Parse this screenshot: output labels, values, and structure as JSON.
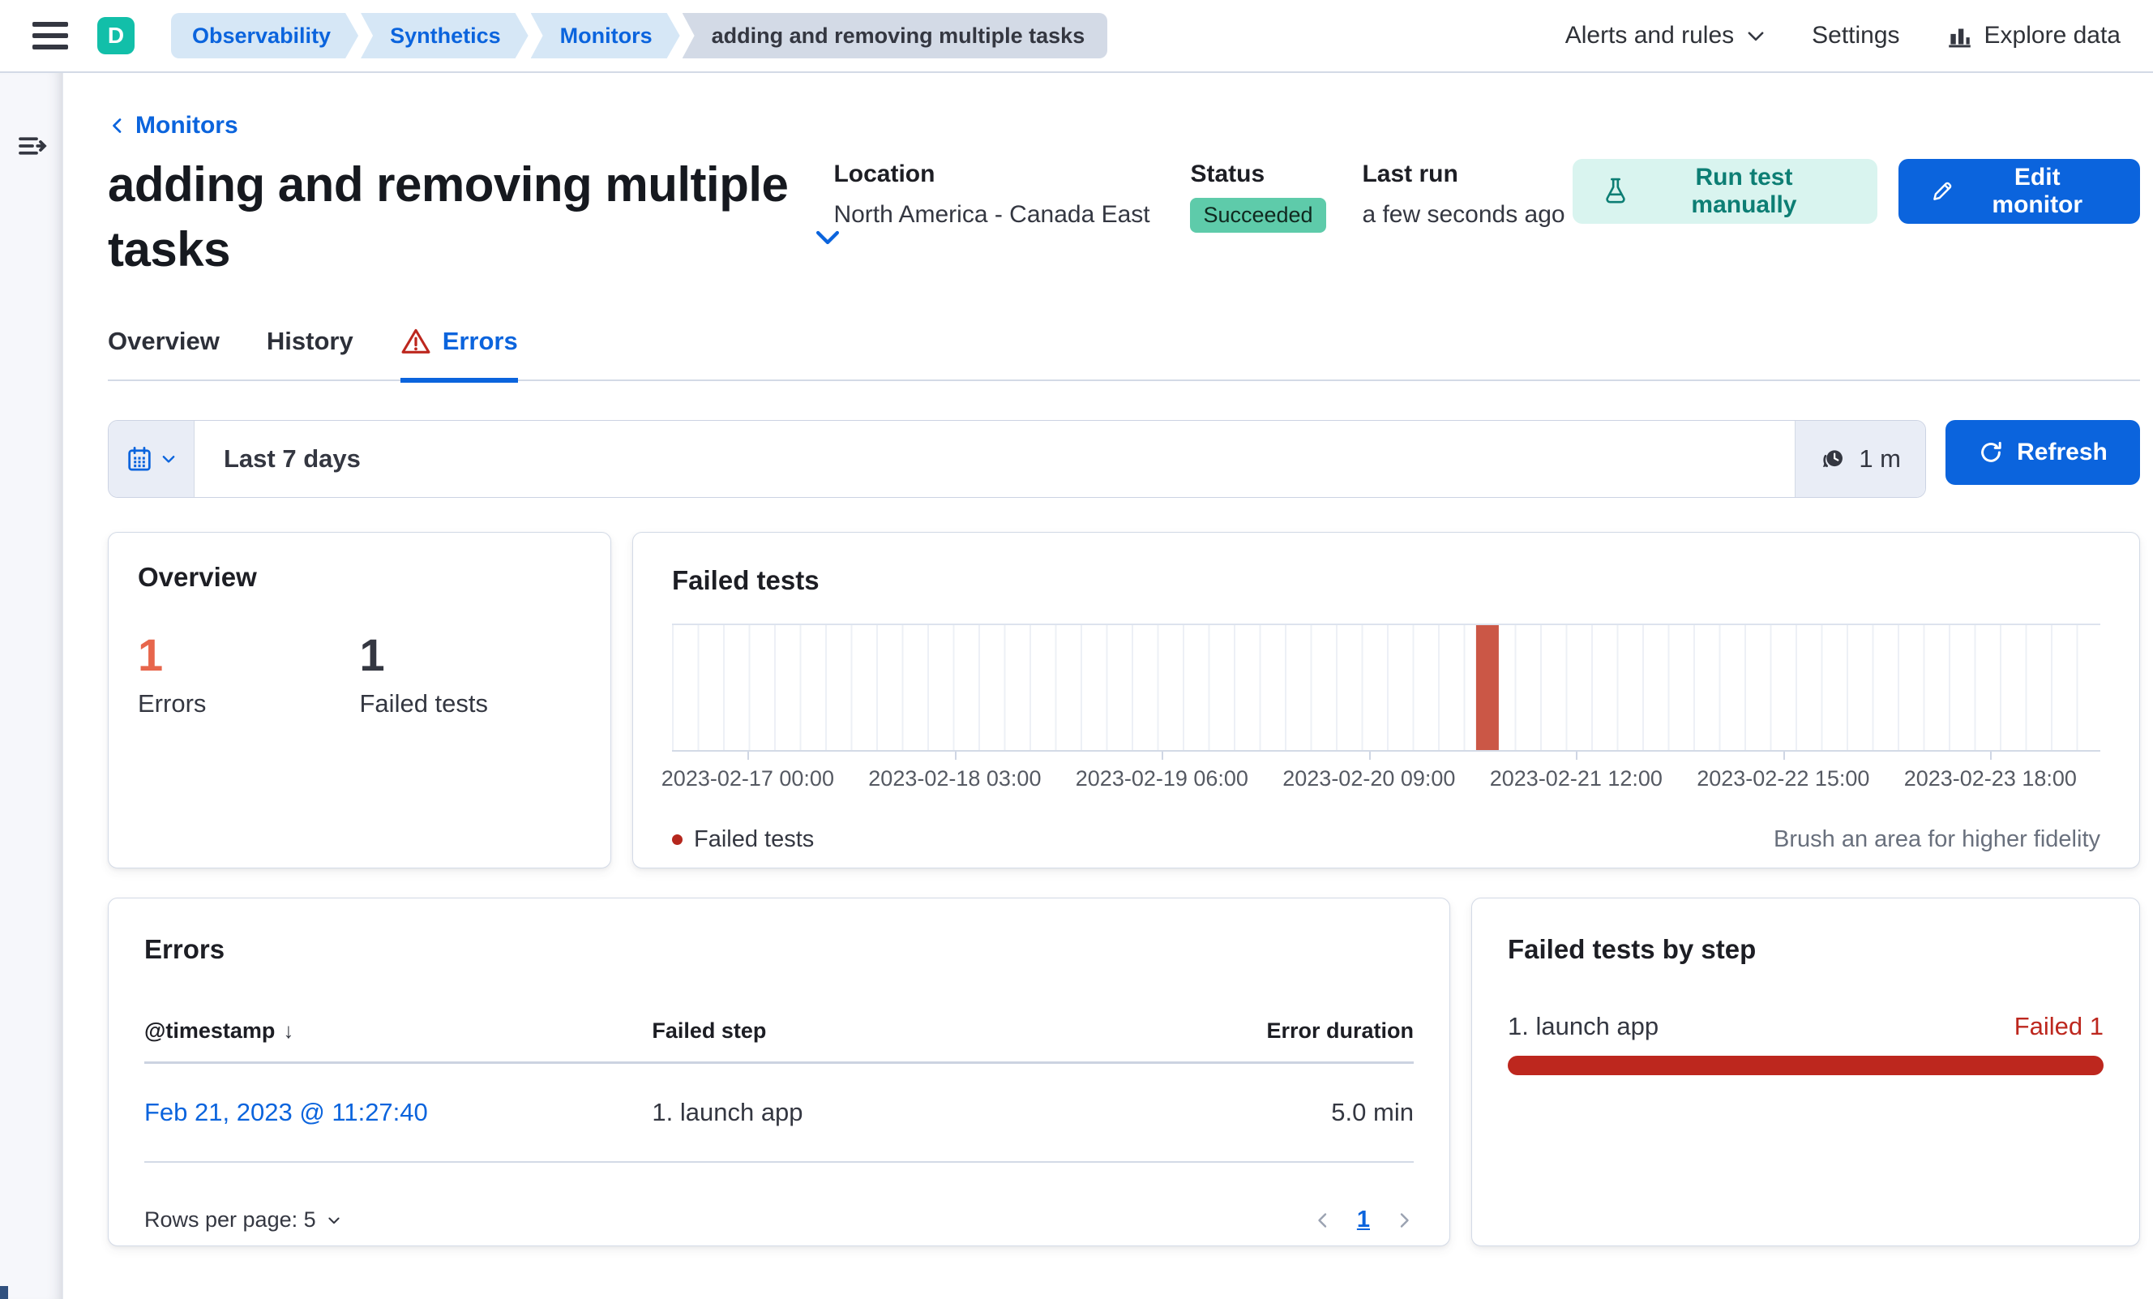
{
  "header": {
    "deployment_initial": "D",
    "breadcrumbs": [
      "Observability",
      "Synthetics",
      "Monitors",
      "adding and removing multiple tasks"
    ],
    "nav": {
      "alerts_and_rules": "Alerts and rules",
      "settings": "Settings",
      "explore_data": "Explore data"
    }
  },
  "page": {
    "back_link": "Monitors",
    "title": "adding and removing multiple tasks",
    "meta": {
      "location_label": "Location",
      "location_value": "North America - Canada East",
      "status_label": "Status",
      "status_value": "Succeeded",
      "last_run_label": "Last run",
      "last_run_value": "a few seconds ago"
    },
    "actions": {
      "run_test_label": "Run test manually",
      "edit_monitor_label": "Edit monitor"
    }
  },
  "tabs": [
    {
      "label": "Overview",
      "active": false
    },
    {
      "label": "History",
      "active": false
    },
    {
      "label": "Errors",
      "active": true
    }
  ],
  "toolbar": {
    "time_range": "Last 7 days",
    "refresh_interval": "1 m",
    "refresh_label": "Refresh"
  },
  "overview_card": {
    "title": "Overview",
    "stats": [
      {
        "value": "1",
        "label": "Errors"
      },
      {
        "value": "1",
        "label": "Failed tests"
      }
    ]
  },
  "chart_card": {
    "title": "Failed tests",
    "legend_label": "Failed tests",
    "hint": "Brush an area for higher fidelity"
  },
  "chart_data": {
    "type": "bar",
    "title": "Failed tests",
    "x_ticks": [
      "2023-02-17 00:00",
      "2023-02-18 03:00",
      "2023-02-19 06:00",
      "2023-02-20 09:00",
      "2023-02-21 12:00",
      "2023-02-22 15:00",
      "2023-02-23 18:00"
    ],
    "xrange": [
      "2023-02-17 00:00",
      "2023-02-24 00:00"
    ],
    "ylim": [
      0,
      1
    ],
    "bucket_hours": 3,
    "series": [
      {
        "name": "Failed tests",
        "color": "#cb5746",
        "points": [
          {
            "x": "2023-02-21 09:00",
            "y": 1
          }
        ]
      }
    ],
    "bar_position_pct": 57.1,
    "bar_width_pct": 1.6,
    "legend_position": "bottom",
    "grid": true
  },
  "errors_card": {
    "title": "Errors",
    "columns": {
      "timestamp": "@timestamp",
      "failed_step": "Failed step",
      "error_duration": "Error duration"
    },
    "rows": [
      {
        "timestamp": "Feb 21, 2023 @ 11:27:40",
        "failed_step": "1. launch app",
        "error_duration": "5.0 min"
      }
    ],
    "rows_per_page": "Rows per page: 5",
    "page": "1"
  },
  "steps_card": {
    "title": "Failed tests by step",
    "items": [
      {
        "step": "1. launch app",
        "status": "Failed 1",
        "fill_pct": 100
      }
    ]
  },
  "colors": {
    "accent_blue": "#0b64dd",
    "success_badge": "#5ecbaa",
    "danger_red": "#bd271e",
    "stat_danger": "#e7664c",
    "chart_bar": "#cb5746",
    "mint_button_bg": "#d9f4ef",
    "mint_button_text": "#0d7e74",
    "avatar_teal": "#12bfa9",
    "border": "#d3dae6"
  }
}
